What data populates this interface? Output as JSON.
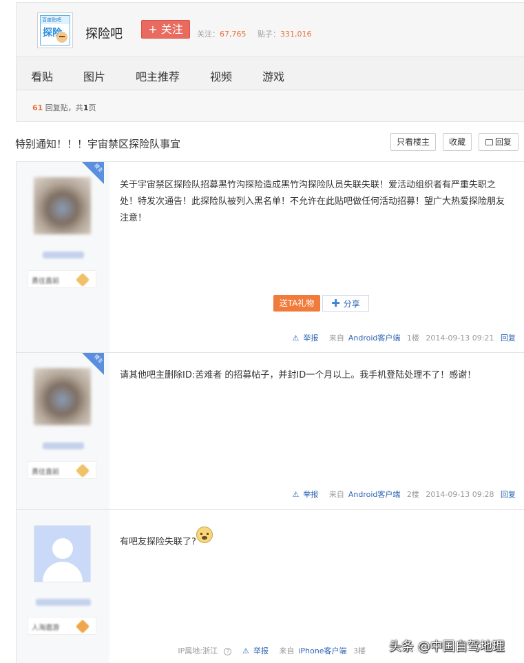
{
  "header": {
    "logo_top_text": "百度贴吧",
    "logo_main_text": "探险",
    "forum_name": "探险吧",
    "follow_label": "+ 关注",
    "follow_stat_label": "关注：",
    "follow_stat_value": "67,765",
    "posts_stat_label": "贴子：",
    "posts_stat_value": "331,016"
  },
  "nav": {
    "items": [
      {
        "label": "看贴"
      },
      {
        "label": "图片"
      },
      {
        "label": "吧主推荐"
      },
      {
        "label": "视频"
      },
      {
        "label": "游戏"
      }
    ]
  },
  "countbar": {
    "count": "61",
    "text_mid": " 回复贴，共",
    "pages": "1",
    "text_end": "页"
  },
  "thread": {
    "title": "特别通知！！！宇宙禁区探险队事宜",
    "only_op_label": "只看楼主",
    "collect_label": "收藏",
    "reply_label": "回复"
  },
  "posts": [
    {
      "corner_tag": "楼主",
      "level_text": "勇往直前",
      "content": "关于宇宙禁区探险队招募黑竹沟探险造成黑竹沟探险队员失联失联！爱活动组织者有严重失职之处！特发次通告！此探险队被列入黑名单！不允许在此贴吧做任何活动招募！望广大热爱探险朋友注意！",
      "gift_label": "送TA礼物",
      "share_label": "分享",
      "report_label": "举报",
      "client_prefix": "来自",
      "client_name": "Android客户端",
      "floor": "1楼",
      "time": "2014-09-13 09:21",
      "reply_label": "回复"
    },
    {
      "corner_tag": "楼主",
      "level_text": "勇往直前",
      "content": "请其他吧主删除ID:苦难者 的招募帖子，并封ID一个月以上。我手机登陆处理不了！感谢！",
      "report_label": "举报",
      "client_prefix": "来自",
      "client_name": "Android客户端",
      "floor": "2楼",
      "time": "2014-09-13 09:28",
      "reply_label": "回复"
    },
    {
      "level_text": "人海遨游",
      "content": "有吧友探险失联了?",
      "emoji": "scared-face",
      "ip_label": "IP属地:浙江",
      "report_label": "举报",
      "client_prefix": "来自",
      "client_name": "iPhone客户端",
      "floor": "3楼"
    }
  ],
  "watermark": "头条 @中国自驾地理",
  "colors": {
    "follow_button": "#e96a5e",
    "stat_number": "#e67340",
    "link_blue": "#2d64b3",
    "gift_button": "#f07b3b",
    "corner_tag": "#5a8fe0"
  }
}
